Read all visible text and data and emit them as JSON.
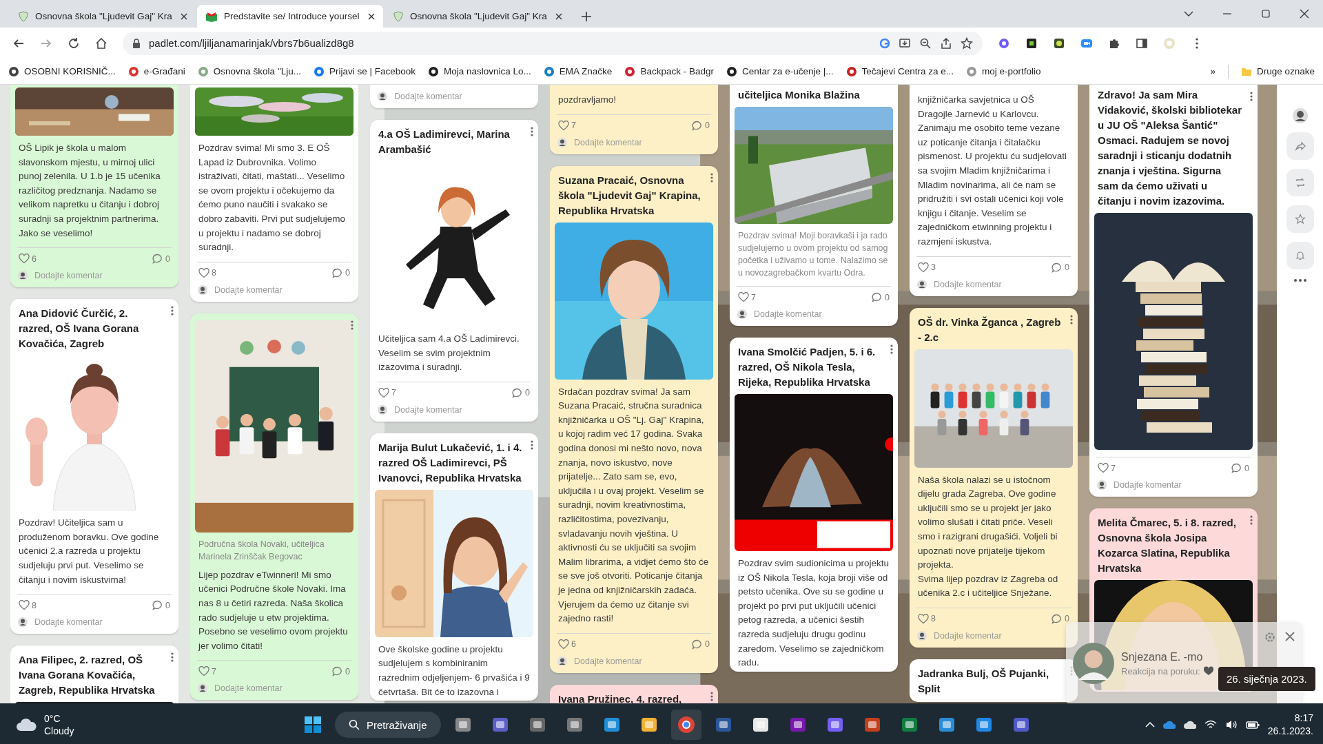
{
  "browser": {
    "tabs": [
      {
        "title": "Osnovna škola \"Ljudevit Gaj\" Kra",
        "selected": false
      },
      {
        "title": "Predstavite se/ Introduce yoursel",
        "selected": true
      },
      {
        "title": "Osnovna škola \"Ljudevit Gaj\" Kra",
        "selected": false
      }
    ],
    "url": "padlet.com/ljiljanamarinjak/vbrs7b6ualizd8g8",
    "bookmarks": [
      "OSOBNI KORISNIČ...",
      "e-Građani",
      "Osnovna škola \"Lju...",
      "Prijavi se | Facebook",
      "Moja naslovnica Lo...",
      "EMA Značke",
      "Backpack - Badgr",
      "Centar za e-učenje |...",
      "Tečajevi Centra za e...",
      "moj e-portfolio"
    ],
    "more_bookmarks": "»",
    "other_bookmarks": "Druge oznake"
  },
  "board": {
    "columns": [
      {
        "cards": [
          {
            "color": "#d9f8d5",
            "menu": false,
            "body": "OŠ Lipik je škola u malom slavonskom mjestu, u mirnoj ulici punoj zelenila. U 1.b je 15 učenika različitog predznanja. Nadamo se velikom napretku u čitanju i dobroj suradnji sa projektnim partnerima. Jako se veselimo!",
            "likes": "6",
            "comments": "0",
            "comment_placeholder": "Dodajte komentar"
          },
          {
            "color": "#ffffff",
            "menu": true,
            "title": "Ana Didović Čurčić, 2. razred, OŠ Ivana Gorana Kovačića, Zagreb",
            "body": "Pozdrav! Učiteljica sam u produženom boravku. Ove godine učenici 2.a razreda u projektu sudjeluju prvi put. Veselimo se čitanju i novim iskustvima!",
            "likes": "8",
            "comments": "0",
            "comment_placeholder": "Dodajte komentar"
          },
          {
            "color": "#ffffff",
            "menu": true,
            "title": "Ana Filipec, 2. razred, OŠ Ivana Gorana Kovačića, Zagreb, Republika Hrvatska"
          }
        ]
      },
      {
        "cards": [
          {
            "color": "#ffffff",
            "menu": false,
            "body": "Pozdrav svima! Mi smo 3. E OŠ Lapad iz Dubrovnika. Volimo istraživati, čitati, maštati... Veselimo se ovom projektu i očekujemo da ćemo puno naučiti i svakako se dobro zabaviti. Prvi put sudjelujemo u projektu i nadamo se dobroj suradnji.",
            "likes": "8",
            "comments": "0",
            "comment_placeholder": "Dodajte komentar"
          },
          {
            "color": "#d9f8d5",
            "menu": true,
            "caption": "Područna škola Novaki, učiteljica Marinela Zrinščak Begovac",
            "body": "Lijep pozdrav eTwinneri! Mi smo učenici Područne škole Novaki. Ima nas 8 u četiri razreda. Naša školica rado sudjeluje u etw projektima. Posebno se veselimo ovom projektu jer volimo čitati!",
            "likes": "7",
            "comments": "0",
            "comment_placeholder": "Dodajte komentar"
          }
        ]
      },
      {
        "cards": [
          {
            "color": "#ffffff",
            "menu": false,
            "comment_placeholder": "Dodajte komentar"
          },
          {
            "color": "#ffffff",
            "menu": true,
            "title": "4.a OŠ Ladimirevci, Marina Arambašić",
            "body": "Učiteljica sam 4.a OŠ Ladimirevci. Veselim se svim projektnim izazovima i suradnji.",
            "likes": "7",
            "comments": "0",
            "comment_placeholder": "Dodajte komentar"
          },
          {
            "color": "#ffffff",
            "menu": true,
            "title": "Marija Bulut Lukačević, 1. i 4. razred OŠ Ladimirevci, PŠ Ivanovci, Republika Hrvatska",
            "body": "Ove školske godine u projektu sudjelujem s kombiniranim razrednim odjeljenjem- 6 prvašića i 9 četvrtaša. Bit će to izazovna i"
          }
        ]
      },
      {
        "cards": [
          {
            "color": "#fdf0c6",
            "menu": false,
            "body": "pozdravljamo!",
            "likes": "7",
            "comments": "0",
            "comment_placeholder": "Dodajte komentar"
          },
          {
            "color": "#fdf0c6",
            "menu": true,
            "title": "Suzana Pracaić, Osnovna škola \"Ljudevit Gaj\" Krapina, Republika Hrvatska",
            "body": "Srdačan pozdrav svima! Ja sam Suzana Pracaić, stručna suradnica knjižničarka u OŠ \"Lj. Gaj\" Krapina, u kojoj radim već 17 godina. Svaka godina donosi mi nešto novo, nova znanja, novo iskustvo, nove prijatelje... Zato sam se, evo, uključila i u ovaj projekt. Veselim se suradnji, novim kreativnostima, različitostima, povezivanju, svladavanju novih vještina. U aktivnosti ću se uključiti sa svojim Malim librarima, a vidjet ćemo što će se sve još otvoriti. Poticanje čitanja je jedna od knjižničarskih zadaća. Vjerujem da ćemo uz čitanje svi zajedno rasti!",
            "likes": "6",
            "comments": "0",
            "comment_placeholder": "Dodajte komentar"
          },
          {
            "color": "#fdd9d9",
            "menu": true,
            "title": "Ivana Pružinec, 4. razred,"
          }
        ]
      },
      {
        "cards": [
          {
            "color": "#ffffff",
            "menu": false,
            "title": "učiteljica Monika Blažina",
            "caption": "Pozdrav svima! Moji boravkaši i ja rado sudjelujemo u ovom projektu od samog početka i uživamo u tome. Nalazimo se u novozagrebačkom kvartu Odra.",
            "likes": "7",
            "comments": "0",
            "comment_placeholder": "Dodajte komentar"
          },
          {
            "color": "#ffffff",
            "menu": true,
            "title": "Ivana Smolčić Padjen, 5. i 6. razred, OŠ Nikola Tesla, Rijeka, Republika Hrvatska",
            "body": "Pozdrav svim sudionicima u projektu iz OŠ Nikola Tesla, koja broji više od petsto učenika. Ove su se godine u projekt po prvi put uključili učenici petog razreda, a učenici šestih razreda sudjeluju drugu godinu zaredom. Veselimo se zajedničkom radu."
          }
        ]
      },
      {
        "cards": [
          {
            "color": "#ffffff",
            "menu": false,
            "body": "knjižničarka savjetnica u OŠ Dragojle Jarnević u Karlovcu. Zanimaju me osobito teme vezane uz poticanje čitanja i čitalačku pismenost. U projektu ću sudjelovati sa svojim Mladim knjižničarima i Mladim novinarima, ali će nam se pridružiti i svi ostali učenici koji vole knjigu i čitanje. Veselim se zajedničkom etwinning projektu i razmjeni iskustva.",
            "likes": "3",
            "comments": "0",
            "comment_placeholder": "Dodajte komentar"
          },
          {
            "color": "#fdf0c6",
            "menu": true,
            "title": "OŠ dr. Vinka Žganca , Zagreb - 2.c",
            "body": "Naša škola nalazi se u istočnom dijelu grada Zagreba. Ove godine uključili smo se u projekt jer jako volimo slušati i čitati priče. Veseli smo i razigrani drugašići. Voljeli bi upoznati nove prijatelje tijekom projekta.\nSvima lijep pozdrav iz Zagreba od učenika 2.c i učiteljice Snježane.",
            "likes": "8",
            "comments": "0",
            "comment_placeholder": "Dodajte komentar"
          },
          {
            "color": "#ffffff",
            "menu": true,
            "title": "Jadranka Bulj, OŠ Pujanki, Split"
          }
        ]
      },
      {
        "cards": [
          {
            "color": "#ffffff",
            "menu": true,
            "title": "Zdravo! Ja sam Mira Vidaković, školski bibliotekar u JU OŠ \"Aleksa Šantić\" Osmaci. Radujem se novoj saradnji i sticanju dodatnih znanja i vještina. Sigurna sam da ćemo uživati u čitanju i novim izazovima.",
            "likes": "7",
            "comments": "0",
            "comment_placeholder": "Dodajte komentar"
          },
          {
            "color": "#fdd9d9",
            "menu": true,
            "title": "Melita Čmarec, 5. i 8. razred, Osnovna škola Josipa Kozarca Slatina, Republika Hrvatska"
          }
        ]
      }
    ]
  },
  "notification": {
    "name": "Snjezana E. -mo",
    "message": "Reakcija na poruku:"
  },
  "tooltip": "26. siječnja 2023.",
  "taskbar": {
    "temperature": "0°C",
    "weather": "Cloudy",
    "search_label": "Pretraživanje",
    "time": "8:17",
    "date": "26.1.2023."
  }
}
